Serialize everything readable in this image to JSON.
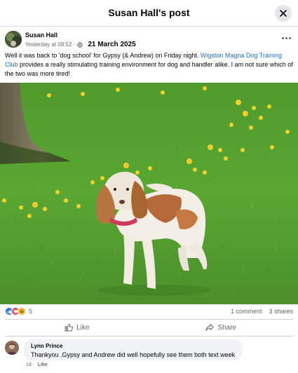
{
  "header": {
    "title": "Susan Hall's post"
  },
  "post": {
    "author": "Susan Hall",
    "time": "Yesterday at 08:52 ·",
    "date": "21 March 2025",
    "text_before": "Well it was back to 'dog school' for Gypsy (& Andrew) on Friday night. ",
    "link_text": "Wigston  Magna Dog Training Club",
    "text_after": " provides a really stimulating training environment for dog and handler alike. I am not sure which of the two was more tired!"
  },
  "stats": {
    "reaction_count": "5",
    "comments": "1 comment",
    "shares": "3 shares"
  },
  "actions": {
    "like": "Like",
    "share": "Share"
  },
  "comment": {
    "name": "Lynn Prince",
    "text": "Thankyou .Gypsy and Andrew did well hopefully see them both text week",
    "age": "1d",
    "like": "Like"
  },
  "icons": {
    "close": "close-icon",
    "more": "more-horizontal-icon",
    "globe": "globe-icon",
    "like_reaction": "like-reaction-icon",
    "love_reaction": "love-reaction-icon",
    "haha_reaction": "haha-reaction-icon",
    "like_action": "thumbs-up-icon",
    "share_action": "share-arrow-icon"
  },
  "colors": {
    "link": "#1b6fd8",
    "like": "#1877f2",
    "love": "#f33e58",
    "haha": "#f7b125"
  }
}
